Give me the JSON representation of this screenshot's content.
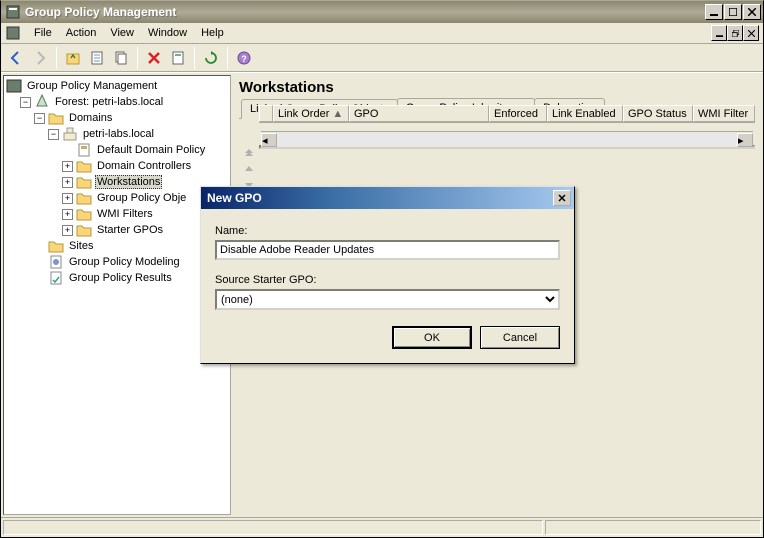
{
  "app": {
    "title": "Group Policy Management"
  },
  "menu": {
    "file": "File",
    "action": "Action",
    "view": "View",
    "window": "Window",
    "help": "Help"
  },
  "tree": {
    "root": "Group Policy Management",
    "forest": "Forest: petri-labs.local",
    "domains": "Domains",
    "domain": "petri-labs.local",
    "defaultPolicy": "Default Domain Policy",
    "domainControllers": "Domain Controllers",
    "workstations": "Workstations",
    "gpoObjects": "Group Policy Obje",
    "wmiFilters": "WMI Filters",
    "starterGpos": "Starter GPOs",
    "sites": "Sites",
    "modeling": "Group Policy Modeling",
    "results": "Group Policy Results"
  },
  "content": {
    "title": "Workstations",
    "tabs": {
      "linked": "Linked Group Policy Objects",
      "inheritance": "Group Policy Inheritance",
      "delegation": "Delegation"
    },
    "columns": {
      "linkOrder": "Link Order",
      "gpo": "GPO",
      "enforced": "Enforced",
      "linkEnabled": "Link Enabled",
      "gpoStatus": "GPO Status",
      "wmiFilter": "WMI Filter"
    }
  },
  "dialog": {
    "title": "New GPO",
    "nameLabel": "Name:",
    "nameValue": "Disable Adobe Reader Updates",
    "starterLabel": "Source Starter GPO:",
    "starterValue": "(none)",
    "ok": "OK",
    "cancel": "Cancel"
  }
}
